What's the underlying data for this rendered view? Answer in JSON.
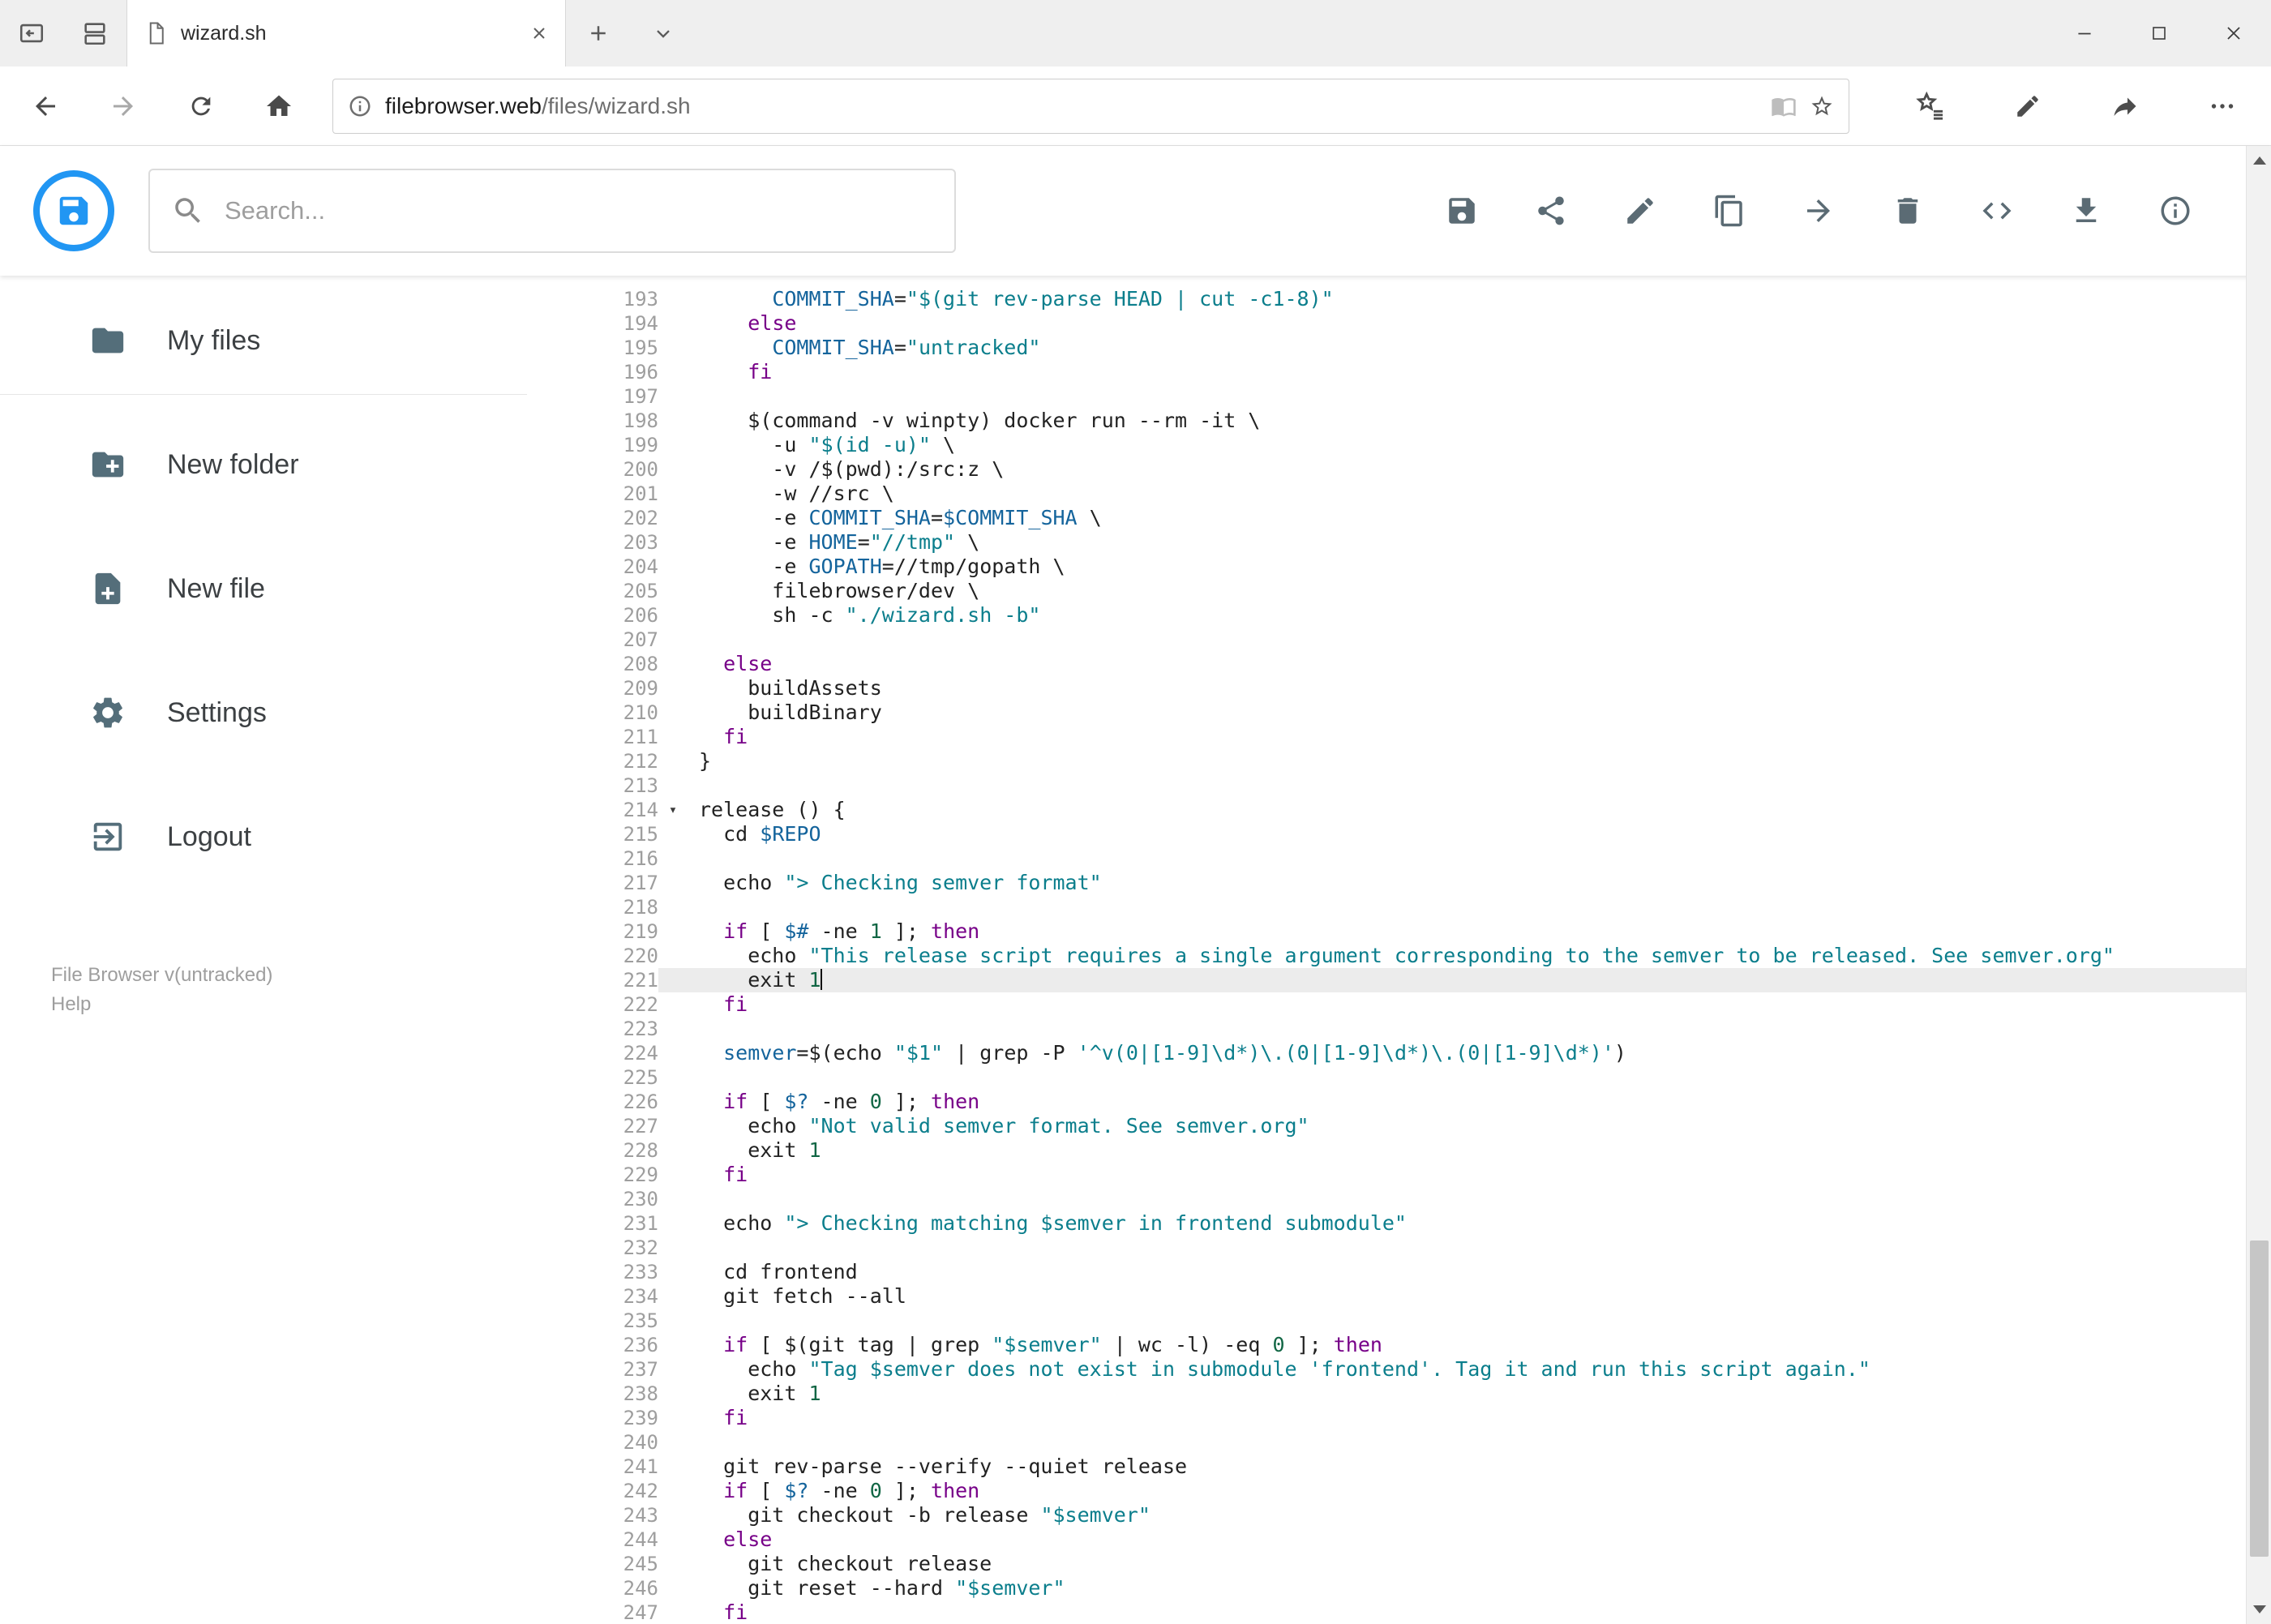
{
  "browser": {
    "tab_title": "wizard.sh",
    "url_host": "filebrowser.web",
    "url_path": "/files/wizard.sh",
    "nav_icons": [
      "back",
      "forward",
      "refresh",
      "home"
    ],
    "address_icons": [
      "page-info",
      "reading-view",
      "favorite-star"
    ],
    "action_icons": [
      "favorites-hub",
      "add-notes",
      "share",
      "more"
    ]
  },
  "header": {
    "search_placeholder": "Search...",
    "accent_color": "#2196f3",
    "icon_color": "#5b6b74",
    "toolbar": [
      {
        "name": "save",
        "icon": "save"
      },
      {
        "name": "share",
        "icon": "share"
      },
      {
        "name": "edit",
        "icon": "pencil"
      },
      {
        "name": "copy",
        "icon": "copy"
      },
      {
        "name": "move",
        "icon": "arrow-forward"
      },
      {
        "name": "delete",
        "icon": "trash"
      },
      {
        "name": "code-view",
        "icon": "code"
      },
      {
        "name": "download",
        "icon": "download"
      },
      {
        "name": "info",
        "icon": "info"
      }
    ]
  },
  "sidebar": {
    "items": [
      {
        "label": "My files",
        "icon": "folder",
        "divider_after": true
      },
      {
        "label": "New folder",
        "icon": "folder-plus"
      },
      {
        "label": "New file",
        "icon": "file-plus"
      },
      {
        "label": "Settings",
        "icon": "gear"
      },
      {
        "label": "Logout",
        "icon": "logout"
      }
    ],
    "footer": {
      "version": "File Browser v(untracked)",
      "help": "Help"
    }
  },
  "editor": {
    "first_line": 193,
    "active_line": 221,
    "fold_marker_line": 214,
    "syntax_colors": {
      "keyword": "#770088",
      "string": "#0b7e8c",
      "variable": "#14649c",
      "number": "#116644",
      "text": "#222222",
      "line_number": "#9e9e9e",
      "active_line_bg": "#ececec"
    },
    "lines": [
      "      COMMIT_SHA=\"$(git rev-parse HEAD | cut -c1-8)\"",
      "    else",
      "      COMMIT_SHA=\"untracked\"",
      "    fi",
      "",
      "    $(command -v winpty) docker run --rm -it \\",
      "      -u \"$(id -u)\" \\",
      "      -v /$(pwd):/src:z \\",
      "      -w //src \\",
      "      -e COMMIT_SHA=$COMMIT_SHA \\",
      "      -e HOME=\"//tmp\" \\",
      "      -e GOPATH=//tmp/gopath \\",
      "      filebrowser/dev \\",
      "      sh -c \"./wizard.sh -b\"",
      "",
      "  else",
      "    buildAssets",
      "    buildBinary",
      "  fi",
      "}",
      "",
      "release () {",
      "  cd $REPO",
      "",
      "  echo \"> Checking semver format\"",
      "",
      "  if [ $# -ne 1 ]; then",
      "    echo \"This release script requires a single argument corresponding to the semver to be released. See semver.org\"",
      "    exit 1",
      "  fi",
      "",
      "  semver=$(echo \"$1\" | grep -P '^v(0|[1-9]\\d*)\\.(0|[1-9]\\d*)\\.(0|[1-9]\\d*)')",
      "",
      "  if [ $? -ne 0 ]; then",
      "    echo \"Not valid semver format. See semver.org\"",
      "    exit 1",
      "  fi",
      "",
      "  echo \"> Checking matching $semver in frontend submodule\"",
      "",
      "  cd frontend",
      "  git fetch --all",
      "",
      "  if [ $(git tag | grep \"$semver\" | wc -l) -eq 0 ]; then",
      "    echo \"Tag $semver does not exist in submodule 'frontend'. Tag it and run this script again.\"",
      "    exit 1",
      "  fi",
      "",
      "  git rev-parse --verify --quiet release",
      "  if [ $? -ne 0 ]; then",
      "    git checkout -b release \"$semver\"",
      "  else",
      "    git checkout release",
      "    git reset --hard \"$semver\"",
      "  fi"
    ]
  }
}
